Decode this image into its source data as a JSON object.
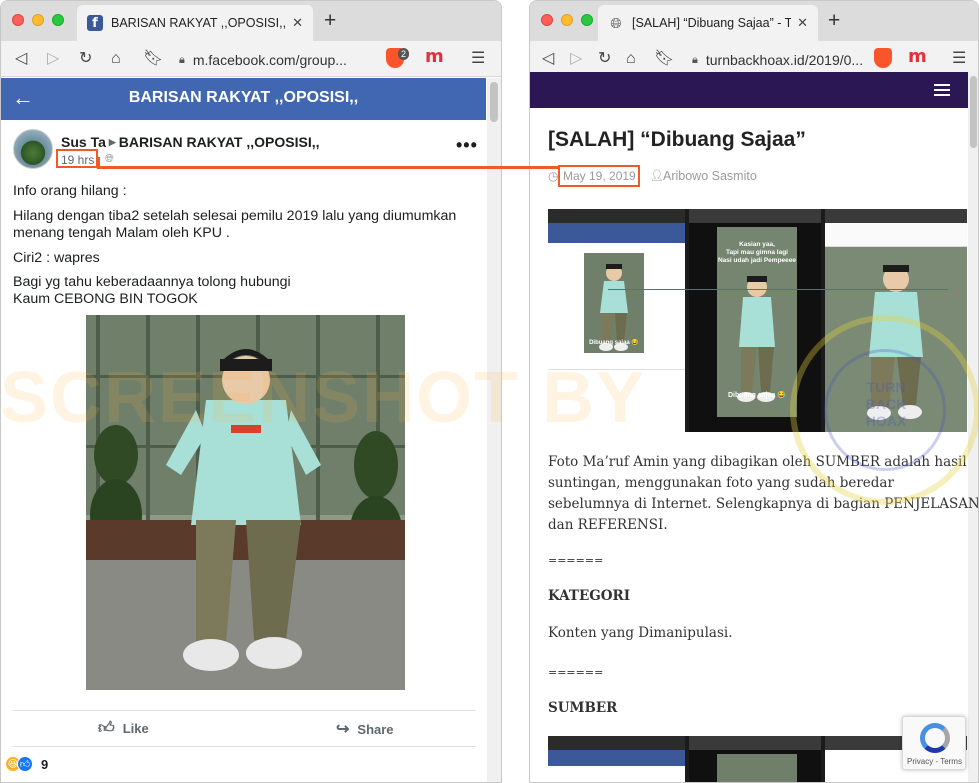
{
  "left_window": {
    "tab_title": "BARISAN RAKYAT ,,OPOSISI,,",
    "close_glyph": "✕",
    "new_tab_glyph": "+",
    "url": "m.facebook.com/group...",
    "brave_badge": "2",
    "ext_label": "m",
    "favicon_label": "f"
  },
  "right_window": {
    "tab_title": "[SALAH] “Dibuang Sajaa” - TurnBa",
    "close_glyph": "✕",
    "new_tab_glyph": "+",
    "url": "turnbackhoax.id/2019/0...",
    "ext_label": "m"
  },
  "facebook": {
    "group_title": "BARISAN RAKYAT ,,OPOSISI,,",
    "poster_name": "Sus Ta",
    "group_name": "BARISAN RAKYAT ,,OPOSISI,,",
    "time": "19 hrs",
    "post_lines": [
      "Info orang hilang :",
      "Hilang dengan tiba2 setelah selesai pemilu 2019 lalu yang diumumkan",
      "menang tengah Malam oleh KPU .",
      "Ciri2 : wapres",
      "Bagi yg tahu keberadaannya tolong hubungi",
      "Kaum CEBONG BIN TOGOK"
    ],
    "like_label": "Like",
    "share_label": "Share",
    "reaction_count": "9",
    "colors": {
      "bar": "#4267b2"
    }
  },
  "watermark": "SCREENSHOT BY",
  "article": {
    "title": "[SALAH] “Dibuang Sajaa”",
    "date": "May 19, 2019",
    "author": "Aribowo Sasmito",
    "intro_lines": [
      "Foto Ma’ruf Amin yang dibagikan oleh SUMBER adalah hasil",
      "suntingan, menggunakan foto yang sudah beredar",
      "sebelumnya di Internet. Selengkapnya di bagian PENJELASAN",
      "dan REFERENSI."
    ],
    "separator_1": "======",
    "kategori_heading": "KATEGORI",
    "kategori_value": "Konten yang Dimanipulasi.",
    "separator_2": "======",
    "sumber_heading": "SUMBER",
    "collage_captions": {
      "panel1_caption": "Dibuang sajaa 😂",
      "panel2_top": "Kasian yaa,",
      "panel2_mid": "Tapi mau gimna lagi",
      "panel2_bottom": "Nasi udah jadi Pempeeee",
      "panel2_caption": "Dibuang sajaa 😂"
    },
    "stamp_text": "TURN BACK HOAX",
    "recaptcha_label": "Privacy - Terms",
    "colors": {
      "bar": "#2c1755",
      "highlight": "#f05a28"
    }
  }
}
